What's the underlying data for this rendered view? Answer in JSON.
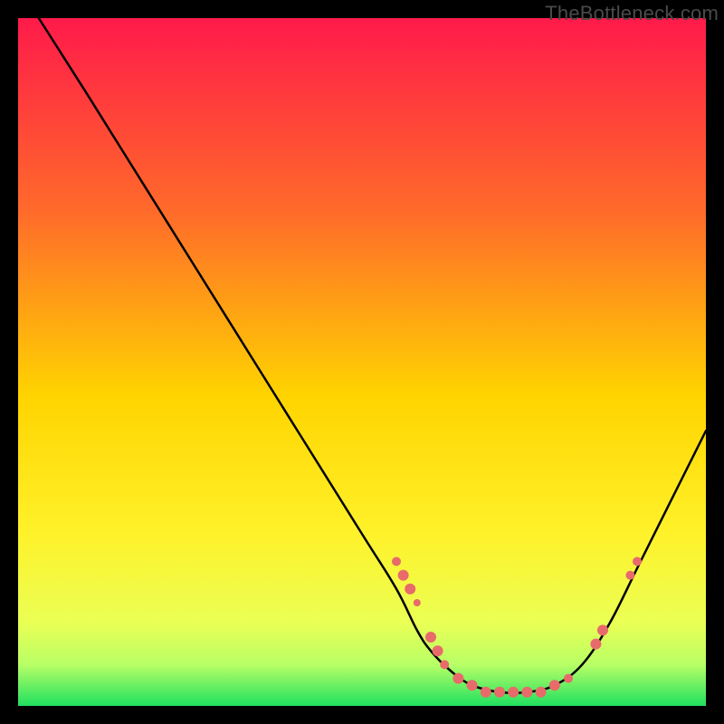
{
  "watermark": "TheBottleneck.com",
  "chart_data": {
    "type": "line",
    "title": "",
    "xlabel": "",
    "ylabel": "",
    "xlim": [
      0,
      100
    ],
    "ylim": [
      0,
      100
    ],
    "gradient_colors": {
      "top": "#ff1a4a",
      "mid_upper": "#ff7a2a",
      "mid": "#ffe000",
      "lower": "#f7ff33",
      "bottom_band": "#d9ff66",
      "bottom": "#20e060"
    },
    "series": [
      {
        "name": "curve",
        "stroke": "#000000",
        "x": [
          3,
          10,
          20,
          30,
          40,
          50,
          55,
          58,
          60,
          63,
          66,
          70,
          74,
          78,
          82,
          86,
          90,
          94,
          98,
          100
        ],
        "y": [
          100,
          89,
          73,
          57,
          41,
          25,
          17,
          11,
          8,
          5,
          3,
          2,
          2,
          3,
          6,
          12,
          20,
          28,
          36,
          40
        ]
      }
    ],
    "scatter": [
      {
        "name": "dots",
        "fill": "#e86a6a",
        "points": [
          {
            "x": 55,
            "y": 21,
            "r": 5
          },
          {
            "x": 56,
            "y": 19,
            "r": 6
          },
          {
            "x": 57,
            "y": 17,
            "r": 6
          },
          {
            "x": 58,
            "y": 15,
            "r": 4
          },
          {
            "x": 60,
            "y": 10,
            "r": 6
          },
          {
            "x": 61,
            "y": 8,
            "r": 6
          },
          {
            "x": 62,
            "y": 6,
            "r": 5
          },
          {
            "x": 64,
            "y": 4,
            "r": 6
          },
          {
            "x": 66,
            "y": 3,
            "r": 6
          },
          {
            "x": 68,
            "y": 2,
            "r": 6
          },
          {
            "x": 70,
            "y": 2,
            "r": 6
          },
          {
            "x": 72,
            "y": 2,
            "r": 6
          },
          {
            "x": 74,
            "y": 2,
            "r": 6
          },
          {
            "x": 76,
            "y": 2,
            "r": 6
          },
          {
            "x": 78,
            "y": 3,
            "r": 6
          },
          {
            "x": 80,
            "y": 4,
            "r": 5
          },
          {
            "x": 84,
            "y": 9,
            "r": 6
          },
          {
            "x": 85,
            "y": 11,
            "r": 6
          },
          {
            "x": 89,
            "y": 19,
            "r": 5
          },
          {
            "x": 90,
            "y": 21,
            "r": 5
          }
        ]
      }
    ]
  }
}
